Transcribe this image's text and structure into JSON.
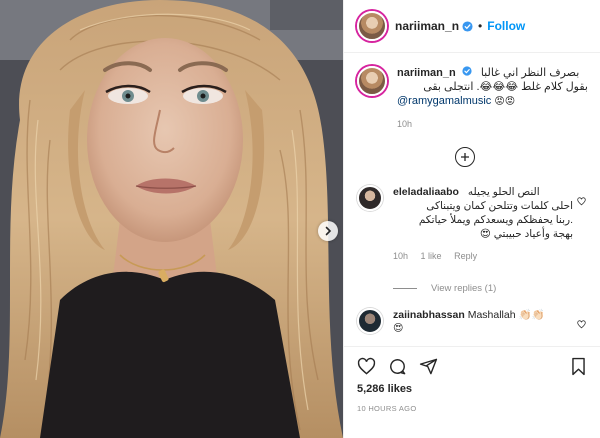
{
  "post": {
    "username": "nariiman_n",
    "follow_label": "Follow",
    "separator": "•"
  },
  "caption": {
    "username": "nariiman_n",
    "line1": "بصرف النظر اني غالبا",
    "line2": "بقول كلام غلط 😂😂😂. انتجلى بقى",
    "mention": "@ramygamalmusic",
    "mention_emoji": "😡😡",
    "time": "10h"
  },
  "comments": [
    {
      "username": "eleladaliaabo",
      "lines": [
        "النص الحلو يجيله",
        "احلى كلمات وتتلحن كمان ويتبناكى",
        ".ربنا يحفظكم ويسعدكم ويملأ حياتكم",
        "بهجة وأعياد حبيبتي 😍"
      ],
      "time": "10h",
      "likes": "1 like",
      "reply": "Reply"
    },
    {
      "username": "zaiinabhassan",
      "text": "Mashallah 👏🏻👏🏻",
      "emoji_line": "😍"
    }
  ],
  "view_replies": "View replies (1)",
  "likes_text": "5,286 likes",
  "timestamp_text": "10 HOURS AGO",
  "icons": [
    "heart-icon",
    "comment-icon",
    "share-icon",
    "bookmark-icon",
    "add-comment-icon",
    "verified-badge-icon",
    "chevron-right-icon"
  ],
  "colors": {
    "follow": "#0095f6",
    "verified": "#3897f0",
    "muted": "#8e8e8e"
  }
}
